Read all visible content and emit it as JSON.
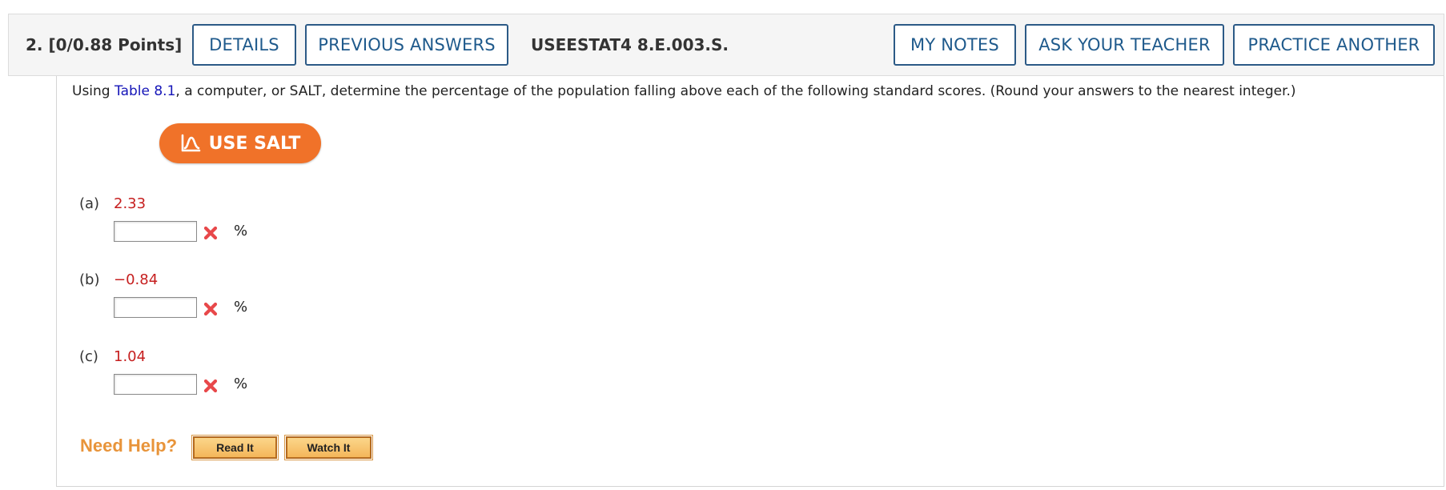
{
  "header": {
    "question_number": "2.",
    "points": "[0/0.88 Points]",
    "details_label": "DETAILS",
    "previous_answers_label": "PREVIOUS ANSWERS",
    "assignment_id": "USEESTAT4 8.E.003.S.",
    "my_notes_label": "MY NOTES",
    "ask_teacher_label": "ASK YOUR TEACHER",
    "practice_another_label": "PRACTICE ANOTHER"
  },
  "question": {
    "prefix": "Using ",
    "table_link": "Table 8.1",
    "suffix": ", a computer, or SALT, determine the percentage of the population falling above each of the following standard scores. (Round your answers to the nearest integer.)"
  },
  "salt": {
    "label": "USE SALT"
  },
  "parts": [
    {
      "label": "(a)",
      "value": "2.33",
      "answer": "",
      "unit": "%",
      "status": "incorrect"
    },
    {
      "label": "(b)",
      "value": "−0.84",
      "answer": "",
      "unit": "%",
      "status": "incorrect"
    },
    {
      "label": "(c)",
      "value": "1.04",
      "answer": "",
      "unit": "%",
      "status": "incorrect"
    }
  ],
  "help": {
    "label": "Need Help?",
    "read_it_label": "Read It",
    "watch_it_label": "Watch It"
  },
  "colors": {
    "header_button_border": "#2c5a86",
    "header_button_text": "#1f5a8c",
    "salt_orange": "#f07229",
    "value_red": "#c61f1f",
    "link_blue": "#1515b8",
    "need_help_orange": "#e8943a",
    "incorrect_mark": "#e8484a"
  },
  "icons": {
    "salt": "chart-bell-curve-icon",
    "incorrect": "red-x-icon"
  }
}
